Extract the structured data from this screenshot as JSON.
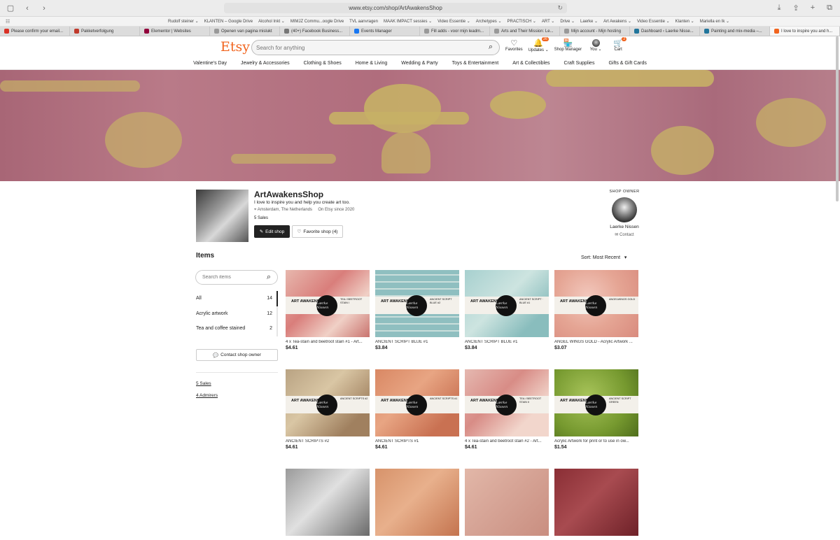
{
  "browser": {
    "url": "www.etsy.com/shop/ArtAwakensShop",
    "bookmarks": [
      "Rudolf steiner ⌄",
      "KLANTEN – Google Drive",
      "Alcohol Inkt ⌄",
      "MIMJZ Commu...oogle Drive",
      "TVL aanvragen",
      "MAAK IMPACT sessies ⌄",
      "Video Essentie ⌄",
      "Archetypes ⌄",
      "PRACTISCH ⌄",
      "ART ⌄",
      "Drive ⌄",
      "Laerke ⌄",
      "Art Awakens ⌄",
      "Video Essentie ⌄",
      "Klanten ⌄",
      "Mariella en Ik ⌄"
    ],
    "tabs": [
      {
        "label": "Please confirm your email...",
        "color": "#d93025"
      },
      {
        "label": "Pakketverfolgung",
        "color": "#c0392b"
      },
      {
        "label": "Elementor | Websites",
        "color": "#92003b"
      },
      {
        "label": "Openen van pagina mislukt",
        "color": "#999999"
      },
      {
        "label": "(40+) Facebook Business...",
        "color": "#777777"
      },
      {
        "label": "Events Manager",
        "color": "#1877f2"
      },
      {
        "label": "Fill adds - voor mijn leadm...",
        "color": "#999999"
      },
      {
        "label": "Arts and Their Mission: Le...",
        "color": "#999999"
      },
      {
        "label": "Mijn account - Mijn hosting",
        "color": "#999999"
      },
      {
        "label": "Dashboard ‹ Laerke Nisse...",
        "color": "#21759b"
      },
      {
        "label": "Painting and mix-media –...",
        "color": "#21759b"
      },
      {
        "label": "I love to inspire you and h...",
        "color": "#f1641e"
      }
    ]
  },
  "header": {
    "logo": "Etsy",
    "search_placeholder": "Search for anything",
    "icons": [
      {
        "label": "Favorites",
        "icon": "heart-icon",
        "glyph": "♡",
        "badge": ""
      },
      {
        "label": "Updates ⌄",
        "icon": "bell-icon",
        "glyph": "🔔",
        "badge": "26"
      },
      {
        "label": "Shop Manager",
        "icon": "shop-icon",
        "glyph": "🏪",
        "badge": ""
      },
      {
        "label": "You ⌄",
        "icon": "avatar",
        "glyph": "",
        "badge": ""
      },
      {
        "label": "Cart",
        "icon": "cart-icon",
        "glyph": "🛒",
        "badge": "2"
      }
    ]
  },
  "categories": [
    "Valentine's Day",
    "Jewelry & Accessories",
    "Clothing & Shoes",
    "Home & Living",
    "Wedding & Party",
    "Toys & Entertainment",
    "Art & Collectibles",
    "Craft Supplies",
    "Gifts & Gift Cards"
  ],
  "shop": {
    "name": "ArtAwakensShop",
    "tagline": "I love to inspire you and help you create art too.",
    "location": "Amsterdam, The Netherlands",
    "since": "On Etsy since 2020",
    "sales": "5 Sales",
    "edit_label": "Edit shop",
    "favorite_label": "Favorite shop (4)",
    "owner_label": "SHOP OWNER",
    "owner_name": "Laerke Nissen",
    "contact_label": "Contact"
  },
  "items_section": {
    "title": "Items",
    "sort_label": "Sort: Most Recent",
    "search_placeholder": "Search items",
    "categories": [
      {
        "label": "All",
        "count": "14"
      },
      {
        "label": "Acrylic artwork",
        "count": "12"
      },
      {
        "label": "Tea and coffee stained",
        "count": "2"
      }
    ],
    "contact_owner": "Contact shop owner",
    "sales_link": "5 Sales",
    "admirers_link": "4 Admirers"
  },
  "listings": [
    {
      "title": "4 x Tea-stain and beetroot stain #1 - Art...",
      "price": "$4.61",
      "bg": "linear-gradient(135deg,#e7b7ad,#d97e7b 40%,#f0d0c6 70%,#c9736e)",
      "label": "TEA / BEETROOT STAIN I"
    },
    {
      "title": "ANCIENT SCRIPT BLUE #1",
      "price": "$3.84",
      "bg": "repeating-linear-gradient(0deg,#8fbfc0 0 8px,#c9dedb 8px 10px)",
      "label": "ANCIENT SCRIPT BLUE #2"
    },
    {
      "title": "ANCIENT SCRIPT BLUE #1",
      "price": "$3.84",
      "bg": "linear-gradient(135deg,#a7d0cf,#cde4e0 45%,#89bdbd 80%)",
      "label": "ANCIENT SCRIPT · BLUE #1"
    },
    {
      "title": "ANGEL WINGS GOLD - Acrylic Artwork ...",
      "price": "$3.07",
      "bg": "radial-gradient(circle at 40% 40%,#f2c8bd,#e5a594 50%,#d98b7e)",
      "label": "ANGELWINGS GOLD"
    },
    {
      "title": "ANCIENT SCRIPTS #2",
      "price": "$4.61",
      "bg": "linear-gradient(135deg,#b9a383,#d9c6a4 40%,#a0805f 80%)",
      "label": "ANCIENT SCRIPTS #2"
    },
    {
      "title": "ANCIENT SCRIPTS #1",
      "price": "$4.61",
      "bg": "linear-gradient(135deg,#d98864,#e8a583 40%,#c97152 80%)",
      "label": "ANCIENT SCRIPTS #1"
    },
    {
      "title": "4 x Tea-stain and beetroot stain #2 - Art...",
      "price": "$4.61",
      "bg": "linear-gradient(135deg,#e5b8b0,#d88c86 40%,#f2d6cc 75%)",
      "label": "TEA / BEETROOT STAIN II"
    },
    {
      "title": "Acrylic Artwork for print or to use in ow...",
      "price": "$1.54",
      "bg": "radial-gradient(circle at 40% 40%,#a8c45a,#76992f 60%,#4f6e1c)",
      "label": "ANCIENT SCRIPT GREEN"
    },
    {
      "title": "",
      "price": "",
      "bg": "linear-gradient(135deg,#9a9a9a,#e0e0e0 45%,#6a6a6a)",
      "label": ""
    },
    {
      "title": "",
      "price": "",
      "bg": "linear-gradient(135deg,#d7936b,#e8b08c 45%,#c4744f)",
      "label": ""
    },
    {
      "title": "",
      "price": "",
      "bg": "linear-gradient(135deg,#e2b7a8,#d6a496 45%,#c98e80)",
      "label": ""
    },
    {
      "title": "",
      "price": "",
      "bg": "linear-gradient(135deg,#8a2e35,#a84b50 45%,#6e2128)",
      "label": ""
    }
  ],
  "thumb_text": {
    "art": "ART AWAKENS",
    "logo": "Lærke Nissen"
  },
  "colors": {
    "brand": "#f1641e",
    "dark_button": "#222222"
  }
}
